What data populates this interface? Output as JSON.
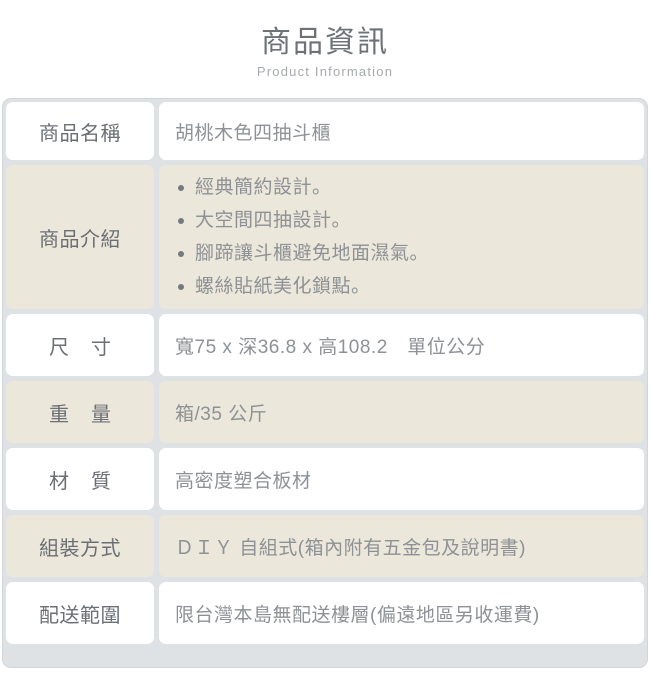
{
  "header": {
    "title": "商品資訊",
    "subtitle": "Product Information"
  },
  "colors": {
    "outer_background": "#ffffff",
    "table_gap": "#dfe2e5",
    "table_border": "#d2d6da",
    "cell_light": "#ffffff",
    "cell_dark": "#ece7db",
    "label_text": "#6b6f74",
    "value_text": "#8e9195",
    "bullet_dot": "#76797d",
    "title_text": "#6e7277",
    "subtitle_text": "#a6a9ad"
  },
  "table": {
    "rows": [
      {
        "label": "商品名稱",
        "value": "胡桃木色四抽斗櫃",
        "tone": "light",
        "spaced_label": false
      },
      {
        "label": "商品介紹",
        "tone": "dark",
        "spaced_label": false,
        "bullets": [
          "經典簡約設計。",
          "大空間四抽設計。",
          "腳蹄讓斗櫃避免地面濕氣。",
          "螺絲貼紙美化鎖點。"
        ]
      },
      {
        "label": "尺寸",
        "value": "寬75 x 深36.8 x 高108.2　單位公分",
        "tone": "light",
        "spaced_label": true
      },
      {
        "label": "重量",
        "value": "箱/35 公斤",
        "tone": "dark",
        "spaced_label": true
      },
      {
        "label": "材質",
        "value": "高密度塑合板材",
        "tone": "light",
        "spaced_label": true
      },
      {
        "label": "組裝方式",
        "value": "ＤＩＹ 自組式(箱內附有五金包及說明書)",
        "tone": "dark",
        "spaced_label": false
      },
      {
        "label": "配送範圍",
        "value": "限台灣本島無配送樓層(偏遠地區另收運費)",
        "tone": "light",
        "spaced_label": false
      }
    ]
  }
}
